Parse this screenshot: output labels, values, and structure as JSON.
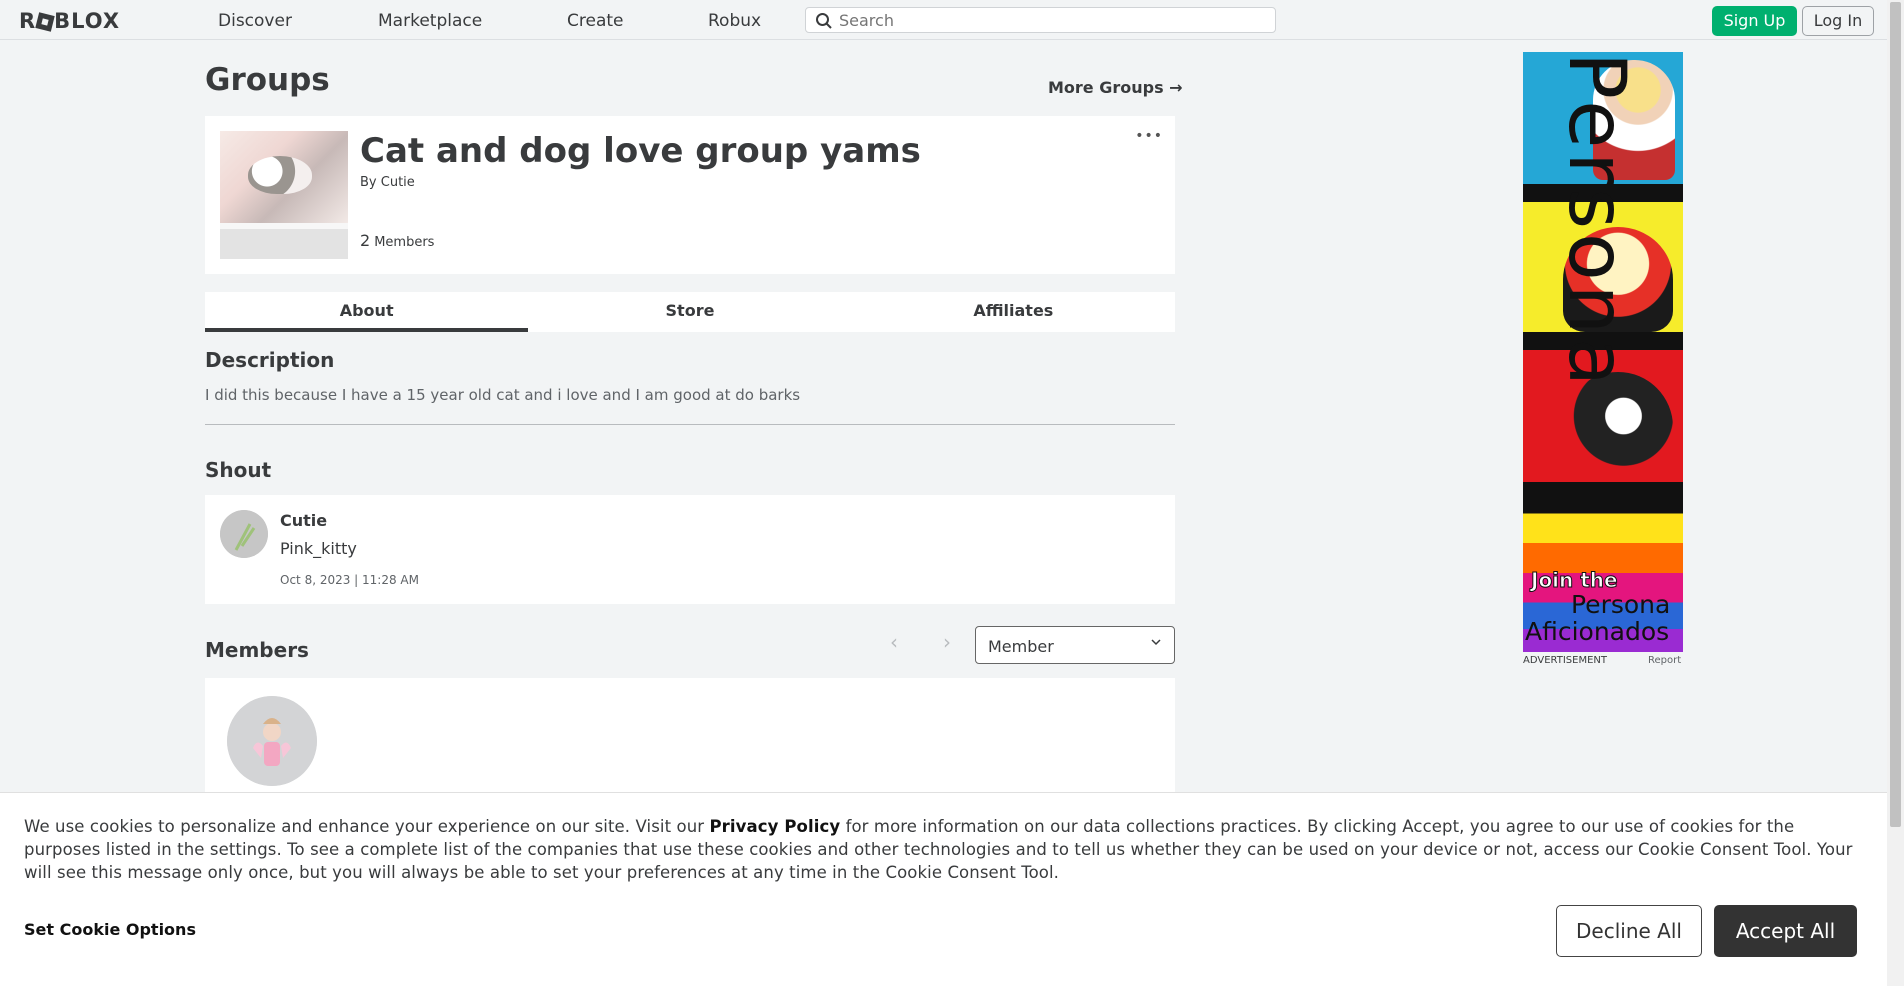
{
  "nav": {
    "logo": "ROBLOX",
    "links": [
      "Discover",
      "Marketplace",
      "Create",
      "Robux"
    ],
    "search_placeholder": "Search",
    "signup_label": "Sign Up",
    "login_label": "Log In"
  },
  "page": {
    "title": "Groups",
    "more_groups": "More Groups →"
  },
  "group": {
    "name": "Cat and dog love group yams",
    "by_prefix": "By",
    "owner": "Cutie",
    "member_count": "2",
    "members_label": "Members",
    "menu": "•••"
  },
  "tabs": [
    "About",
    "Store",
    "Affiliates"
  ],
  "active_tab": "About",
  "about": {
    "description_heading": "Description",
    "description": "I did this because I have a 15 year old cat and i love and I am good at do barks",
    "shout_heading": "Shout",
    "shout": {
      "author": "Cutie",
      "body": "Pink_kitty",
      "date": "Oct 8, 2023 | 11:28 AM"
    },
    "members_heading": "Members",
    "role_filter": "Member",
    "pager_prev": "‹",
    "pager_next": "›"
  },
  "ad": {
    "brand": "Persona",
    "join": "Join the",
    "line1": "Persona",
    "line2": "Aficionados",
    "label": "ADVERTISEMENT",
    "report": "Report"
  },
  "cookie": {
    "text_before_link": "We use cookies to personalize and enhance your experience on our site. Visit our ",
    "link": "Privacy Policy",
    "text_after_link": " for more information on our data collections practices. By clicking Accept, you agree to our use of cookies for the purposes listed in the settings. To see a complete list of the companies that use these cookies and other technologies and to tell us whether they can be used on your device or not, access our Cookie Consent Tool. Your will see this message only once, but you will always be able to set your preferences at any time in the Cookie Consent Tool.",
    "set_options": "Set Cookie Options",
    "decline": "Decline All",
    "accept": "Accept All"
  },
  "colors": {
    "signup_green": "#00b06f",
    "accept_dark": "#333333",
    "background": "#f2f4f5"
  }
}
